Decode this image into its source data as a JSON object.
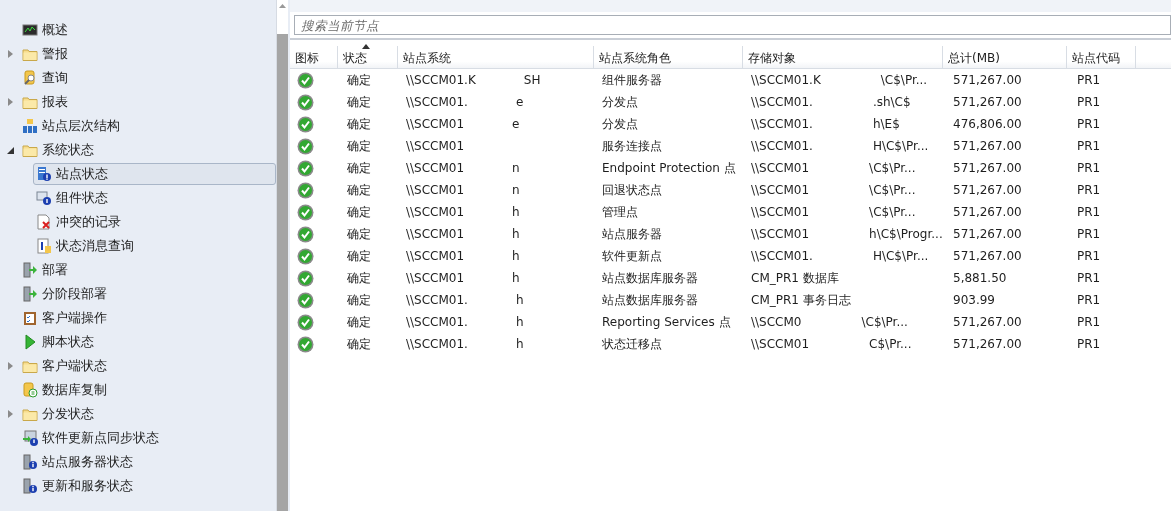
{
  "nav_tree": {
    "items": [
      {
        "label": "概述",
        "kind": "monitor"
      },
      {
        "label": "警报",
        "kind": "folder",
        "expanded": false
      },
      {
        "label": "查询",
        "kind": "query"
      },
      {
        "label": "报表",
        "kind": "folder",
        "expanded": false
      },
      {
        "label": "站点层次结构",
        "kind": "hierarchy"
      },
      {
        "label": "系统状态",
        "kind": "folder",
        "expanded": true,
        "children": [
          {
            "label": "站点状态",
            "kind": "site",
            "selected": true
          },
          {
            "label": "组件状态",
            "kind": "component",
            "selected": false
          },
          {
            "label": "冲突的记录",
            "kind": "conflict",
            "selected": false
          },
          {
            "label": "状态消息查询",
            "kind": "infodoc",
            "selected": false
          }
        ]
      },
      {
        "label": "部署",
        "kind": "deploy"
      },
      {
        "label": "分阶段部署",
        "kind": "deploy"
      },
      {
        "label": "客户端操作",
        "kind": "clipboard"
      },
      {
        "label": "脚本状态",
        "kind": "play"
      },
      {
        "label": "客户端状态",
        "kind": "folder",
        "expanded": false
      },
      {
        "label": "数据库复制",
        "kind": "db"
      },
      {
        "label": "分发状态",
        "kind": "folder",
        "expanded": false
      },
      {
        "label": "软件更新点同步状态",
        "kind": "sync"
      },
      {
        "label": "站点服务器状态",
        "kind": "serverinfo"
      },
      {
        "label": "更新和服务状态",
        "kind": "serverinfo"
      }
    ]
  },
  "search": {
    "placeholder": "搜索当前节点"
  },
  "table": {
    "columns": [
      {
        "label": "图标",
        "sorted": false
      },
      {
        "label": "状态",
        "sorted": true
      },
      {
        "label": "站点系统",
        "sorted": false
      },
      {
        "label": "站点系统角色",
        "sorted": false
      },
      {
        "label": "存储对象",
        "sorted": false
      },
      {
        "label": "总计(MB)",
        "sorted": false
      },
      {
        "label": "站点代码",
        "sorted": false
      }
    ],
    "rows": [
      {
        "status": "确定",
        "site_system": [
          "\\\\SCCM01.K",
          "SH"
        ],
        "role": "组件服务器",
        "storage": [
          "\\\\SCCM01.K",
          "\\C$\\Pr..."
        ],
        "total": "571,267.00",
        "site_code": "PR1"
      },
      {
        "status": "确定",
        "site_system": [
          "\\\\SCCM01.",
          "e"
        ],
        "role": "分发点",
        "storage": [
          "\\\\SCCM01.",
          ".sh\\C$"
        ],
        "total": "571,267.00",
        "site_code": "PR1"
      },
      {
        "status": "确定",
        "site_system": [
          "\\\\SCCM01",
          "e"
        ],
        "role": "分发点",
        "storage": [
          "\\\\SCCM01.",
          "h\\E$"
        ],
        "total": "476,806.00",
        "site_code": "PR1"
      },
      {
        "status": "确定",
        "site_system": [
          "\\\\SCCM01"
        ],
        "role": "服务连接点",
        "storage": [
          "\\\\SCCM01.",
          "H\\C$\\Pr..."
        ],
        "total": "571,267.00",
        "site_code": "PR1"
      },
      {
        "status": "确定",
        "site_system": [
          "\\\\SCCM01",
          "n"
        ],
        "role": "Endpoint Protection 点",
        "storage": [
          "\\\\SCCM01",
          "\\C$\\Pr..."
        ],
        "total": "571,267.00",
        "site_code": "PR1"
      },
      {
        "status": "确定",
        "site_system": [
          "\\\\SCCM01",
          "n"
        ],
        "role": "回退状态点",
        "storage": [
          "\\\\SCCM01",
          "\\C$\\Pr..."
        ],
        "total": "571,267.00",
        "site_code": "PR1"
      },
      {
        "status": "确定",
        "site_system": [
          "\\\\SCCM01",
          "h"
        ],
        "role": "管理点",
        "storage": [
          "\\\\SCCM01",
          "\\C$\\Pr..."
        ],
        "total": "571,267.00",
        "site_code": "PR1"
      },
      {
        "status": "确定",
        "site_system": [
          "\\\\SCCM01",
          "h"
        ],
        "role": "站点服务器",
        "storage": [
          "\\\\SCCM01",
          "h\\C$\\Progr..."
        ],
        "total": "571,267.00",
        "site_code": "PR1"
      },
      {
        "status": "确定",
        "site_system": [
          "\\\\SCCM01",
          "h"
        ],
        "role": "软件更新点",
        "storage": [
          "\\\\SCCM01.",
          "H\\C$\\Pr..."
        ],
        "total": "571,267.00",
        "site_code": "PR1"
      },
      {
        "status": "确定",
        "site_system": [
          "\\\\SCCM01",
          "h"
        ],
        "role": "站点数据库服务器",
        "storage": [
          "CM_PR1 数据库"
        ],
        "total": "5,881.50",
        "site_code": "PR1"
      },
      {
        "status": "确定",
        "site_system": [
          "\\\\SCCM01.",
          "h"
        ],
        "role": "站点数据库服务器",
        "storage": [
          "CM_PR1 事务日志"
        ],
        "total": "903.99",
        "site_code": "PR1"
      },
      {
        "status": "确定",
        "site_system": [
          "\\\\SCCM01.",
          "h"
        ],
        "role": "Reporting Services 点",
        "storage": [
          "\\\\SCCM0",
          "\\C$\\Pr..."
        ],
        "total": "571,267.00",
        "site_code": "PR1"
      },
      {
        "status": "确定",
        "site_system": [
          "\\\\SCCM01.",
          "h"
        ],
        "role": "状态迁移点",
        "storage": [
          "\\\\SCCM01",
          "C$\\Pr..."
        ],
        "total": "571,267.00",
        "site_code": "PR1"
      }
    ]
  }
}
